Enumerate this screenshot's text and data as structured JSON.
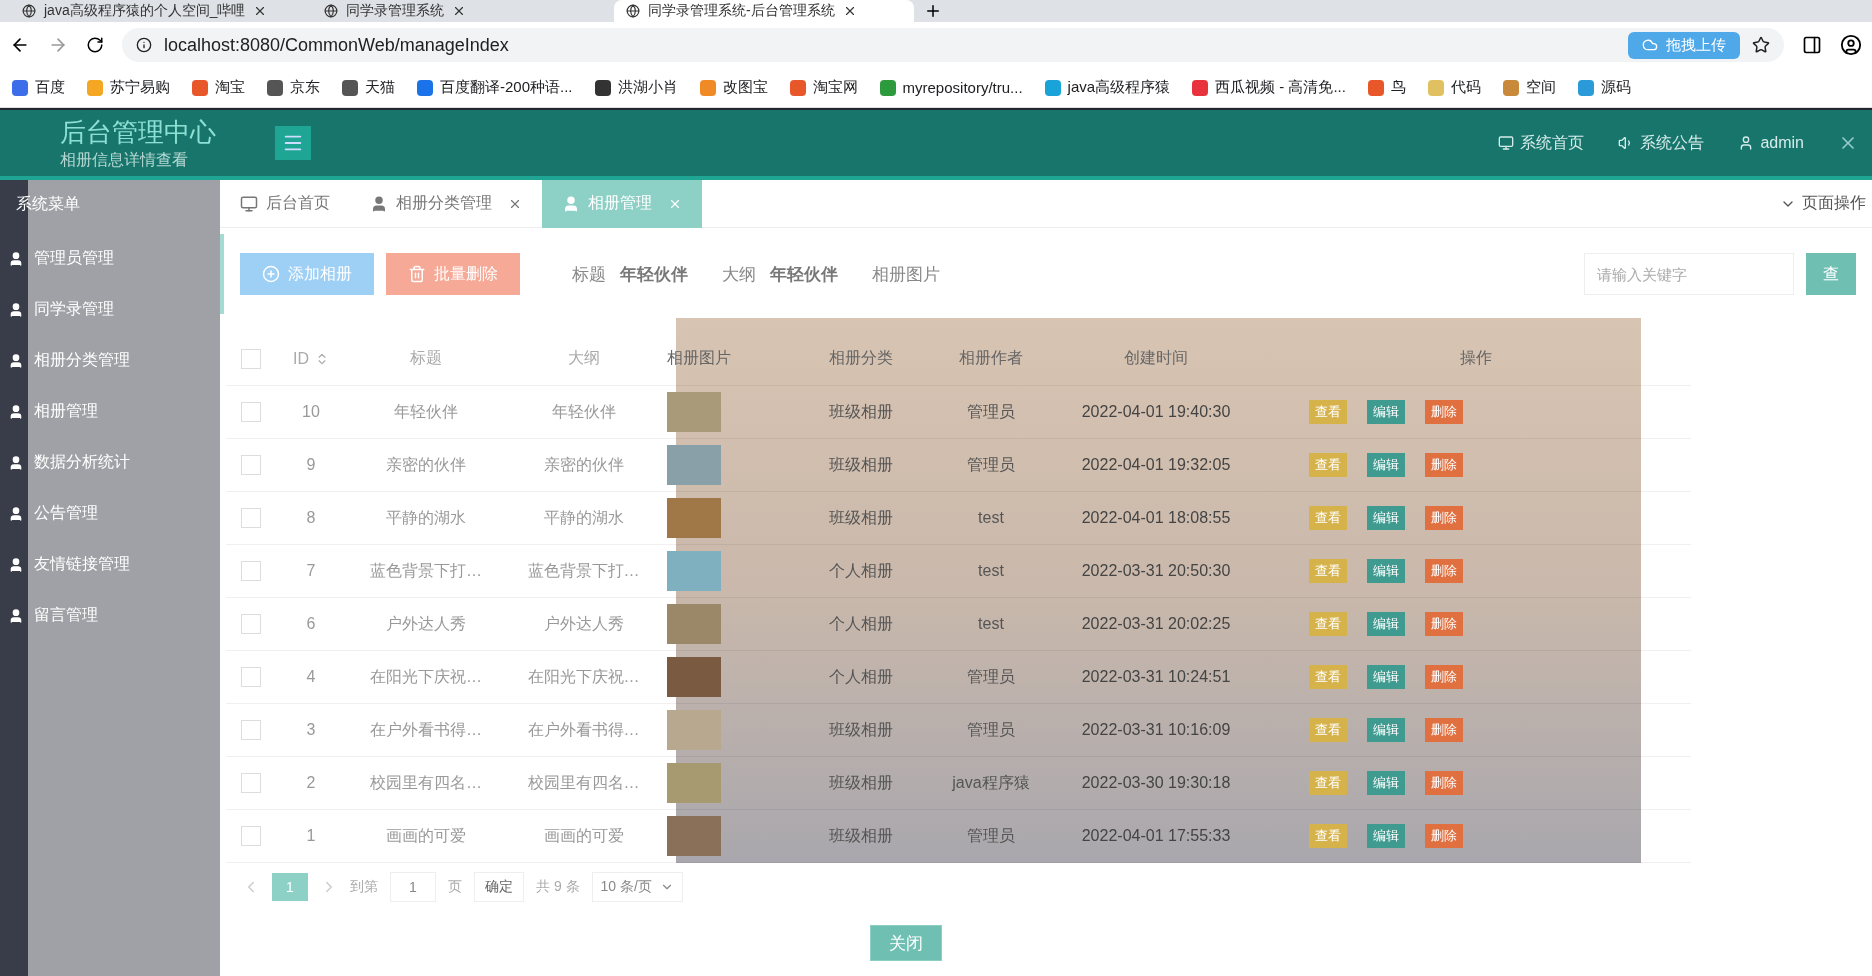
{
  "browser": {
    "tabs": [
      {
        "title": "java高级程序猿的个人空间_哔哩",
        "selected": false
      },
      {
        "title": "同学录管理系统",
        "selected": false
      },
      {
        "title": "同学录管理系统-后台管理系统",
        "selected": true
      }
    ],
    "url": "localhost:8080/CommonWeb/manageIndex",
    "upload_badge": "拖拽上传",
    "bookmarks": [
      "百度",
      "苏宁易购",
      "淘宝",
      "京东",
      "天猫",
      "百度翻译-200种语...",
      "洪湖小肖",
      "改图宝",
      "淘宝网",
      "myrepository/tru...",
      "java高级程序猿",
      "西瓜视频 - 高清免...",
      "鸟",
      "代码",
      "空间",
      "源码"
    ]
  },
  "header": {
    "logo": "后台管理中心",
    "nav": [
      "系统首页",
      "系统公告",
      "admin"
    ]
  },
  "sidebar": {
    "title": "系统菜单",
    "items": [
      "管理员管理",
      "同学录管理",
      "相册分类管理",
      "相册管理",
      "数据分析统计",
      "公告管理",
      "友情链接管理",
      "留言管理"
    ]
  },
  "page_tabs": [
    {
      "label": "后台首页",
      "selected": false,
      "closable": false
    },
    {
      "label": "相册分类管理",
      "selected": false,
      "closable": true
    },
    {
      "label": "相册管理",
      "selected": true,
      "closable": true
    }
  ],
  "page_ops": "页面操作",
  "toolbar": {
    "buttons": [
      {
        "label": "添加相册",
        "kind": "add"
      },
      {
        "label": "批量删除",
        "kind": "delete"
      }
    ],
    "search_placeholder": "请输入关键字",
    "search_button": "查"
  },
  "modal": {
    "title": "相册信息详情查看",
    "fields": [
      {
        "label": "标题",
        "value": "年轻伙伴"
      },
      {
        "label": "大纲",
        "value": "年轻伙伴"
      },
      {
        "label": "相册图片"
      }
    ],
    "close_button": "关闭"
  },
  "table": {
    "all_checked": false,
    "columns": [
      {
        "label": "ID",
        "sortable": true
      },
      {
        "label": "标题",
        "sortable": false
      },
      {
        "label": "大纲",
        "sortable": false
      },
      {
        "label": "相册图片",
        "sortable": false
      },
      {
        "label": "相册分类",
        "sortable": false
      },
      {
        "label": "相册作者",
        "sortable": false
      },
      {
        "label": "创建时间",
        "sortable": false
      },
      {
        "label": "操作",
        "sortable": false
      }
    ],
    "rows": [
      {
        "checked": false,
        "id": "10",
        "title": "年轻伙伴",
        "outline": "年轻伙伴",
        "category": "班级相册",
        "author": "管理员",
        "created": "2022-04-01 19:40:30",
        "actions": [
          {
            "label": "查看",
            "kind": "view"
          },
          {
            "label": "编辑",
            "kind": "edit"
          },
          {
            "label": "删除",
            "kind": "delete"
          }
        ]
      },
      {
        "checked": false,
        "id": "9",
        "title": "亲密的伙伴",
        "outline": "亲密的伙伴",
        "category": "班级相册",
        "author": "管理员",
        "created": "2022-04-01 19:32:05",
        "actions": [
          {
            "label": "查看",
            "kind": "view"
          },
          {
            "label": "编辑",
            "kind": "edit"
          },
          {
            "label": "删除",
            "kind": "delete"
          }
        ]
      },
      {
        "checked": false,
        "id": "8",
        "title": "平静的湖水",
        "outline": "平静的湖水",
        "category": "班级相册",
        "author": "test",
        "created": "2022-04-01 18:08:55",
        "actions": [
          {
            "label": "查看",
            "kind": "view"
          },
          {
            "label": "编辑",
            "kind": "edit"
          },
          {
            "label": "删除",
            "kind": "delete"
          }
        ]
      },
      {
        "checked": false,
        "id": "7",
        "title": "蓝色背景下打…",
        "outline": "蓝色背景下打…",
        "category": "个人相册",
        "author": "test",
        "created": "2022-03-31 20:50:30",
        "actions": [
          {
            "label": "查看",
            "kind": "view"
          },
          {
            "label": "编辑",
            "kind": "edit"
          },
          {
            "label": "删除",
            "kind": "delete"
          }
        ]
      },
      {
        "checked": false,
        "id": "6",
        "title": "户外达人秀",
        "outline": "户外达人秀",
        "category": "个人相册",
        "author": "test",
        "created": "2022-03-31 20:02:25",
        "actions": [
          {
            "label": "查看",
            "kind": "view"
          },
          {
            "label": "编辑",
            "kind": "edit"
          },
          {
            "label": "删除",
            "kind": "delete"
          }
        ]
      },
      {
        "checked": false,
        "id": "4",
        "title": "在阳光下庆祝…",
        "outline": "在阳光下庆祝…",
        "category": "个人相册",
        "author": "管理员",
        "created": "2022-03-31 10:24:51",
        "actions": [
          {
            "label": "查看",
            "kind": "view"
          },
          {
            "label": "编辑",
            "kind": "edit"
          },
          {
            "label": "删除",
            "kind": "delete"
          }
        ]
      },
      {
        "checked": false,
        "id": "3",
        "title": "在户外看书得…",
        "outline": "在户外看书得…",
        "category": "班级相册",
        "author": "管理员",
        "created": "2022-03-31 10:16:09",
        "actions": [
          {
            "label": "查看",
            "kind": "view"
          },
          {
            "label": "编辑",
            "kind": "edit"
          },
          {
            "label": "删除",
            "kind": "delete"
          }
        ]
      },
      {
        "checked": false,
        "id": "2",
        "title": "校园里有四名…",
        "outline": "校园里有四名…",
        "category": "班级相册",
        "author": "java程序猿",
        "created": "2022-03-30 19:30:18",
        "actions": [
          {
            "label": "查看",
            "kind": "view"
          },
          {
            "label": "编辑",
            "kind": "edit"
          },
          {
            "label": "删除",
            "kind": "delete"
          }
        ]
      },
      {
        "checked": false,
        "id": "1",
        "title": "画画的可爱",
        "outline": "画画的可爱",
        "category": "班级相册",
        "author": "管理员",
        "created": "2022-04-01 17:55:33",
        "actions": [
          {
            "label": "查看",
            "kind": "view"
          },
          {
            "label": "编辑",
            "kind": "edit"
          },
          {
            "label": "删除",
            "kind": "delete"
          }
        ]
      }
    ]
  },
  "pagination": {
    "pages": [
      {
        "label": "1",
        "selected": true
      }
    ],
    "goto_label": "到第",
    "page_input": "1",
    "page_unit": "页",
    "confirm": "确定",
    "total": "共 9 条",
    "page_size": "10 条/页"
  }
}
